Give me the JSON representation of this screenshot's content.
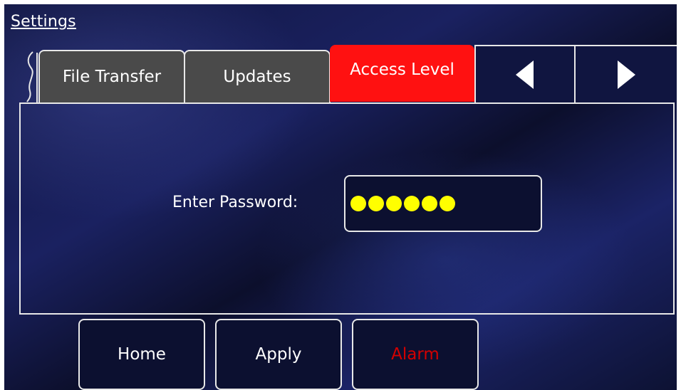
{
  "header": {
    "title": "Settings"
  },
  "tabs": [
    {
      "label": "File Transfer",
      "active": false
    },
    {
      "label": "Updates",
      "active": false
    },
    {
      "label": "Access Level",
      "active": true
    }
  ],
  "nav": {
    "prev_icon": "triangle-left-icon",
    "next_icon": "triangle-right-icon"
  },
  "password": {
    "label": "Enter Password:",
    "masked_length": 6,
    "mask_color": "#ffff00"
  },
  "footer": {
    "home_label": "Home",
    "apply_label": "Apply",
    "alarm_label": "Alarm"
  },
  "colors": {
    "active_tab": "#ff1111",
    "inactive_tab": "#4a4a4a",
    "alarm_text": "#d40000"
  }
}
